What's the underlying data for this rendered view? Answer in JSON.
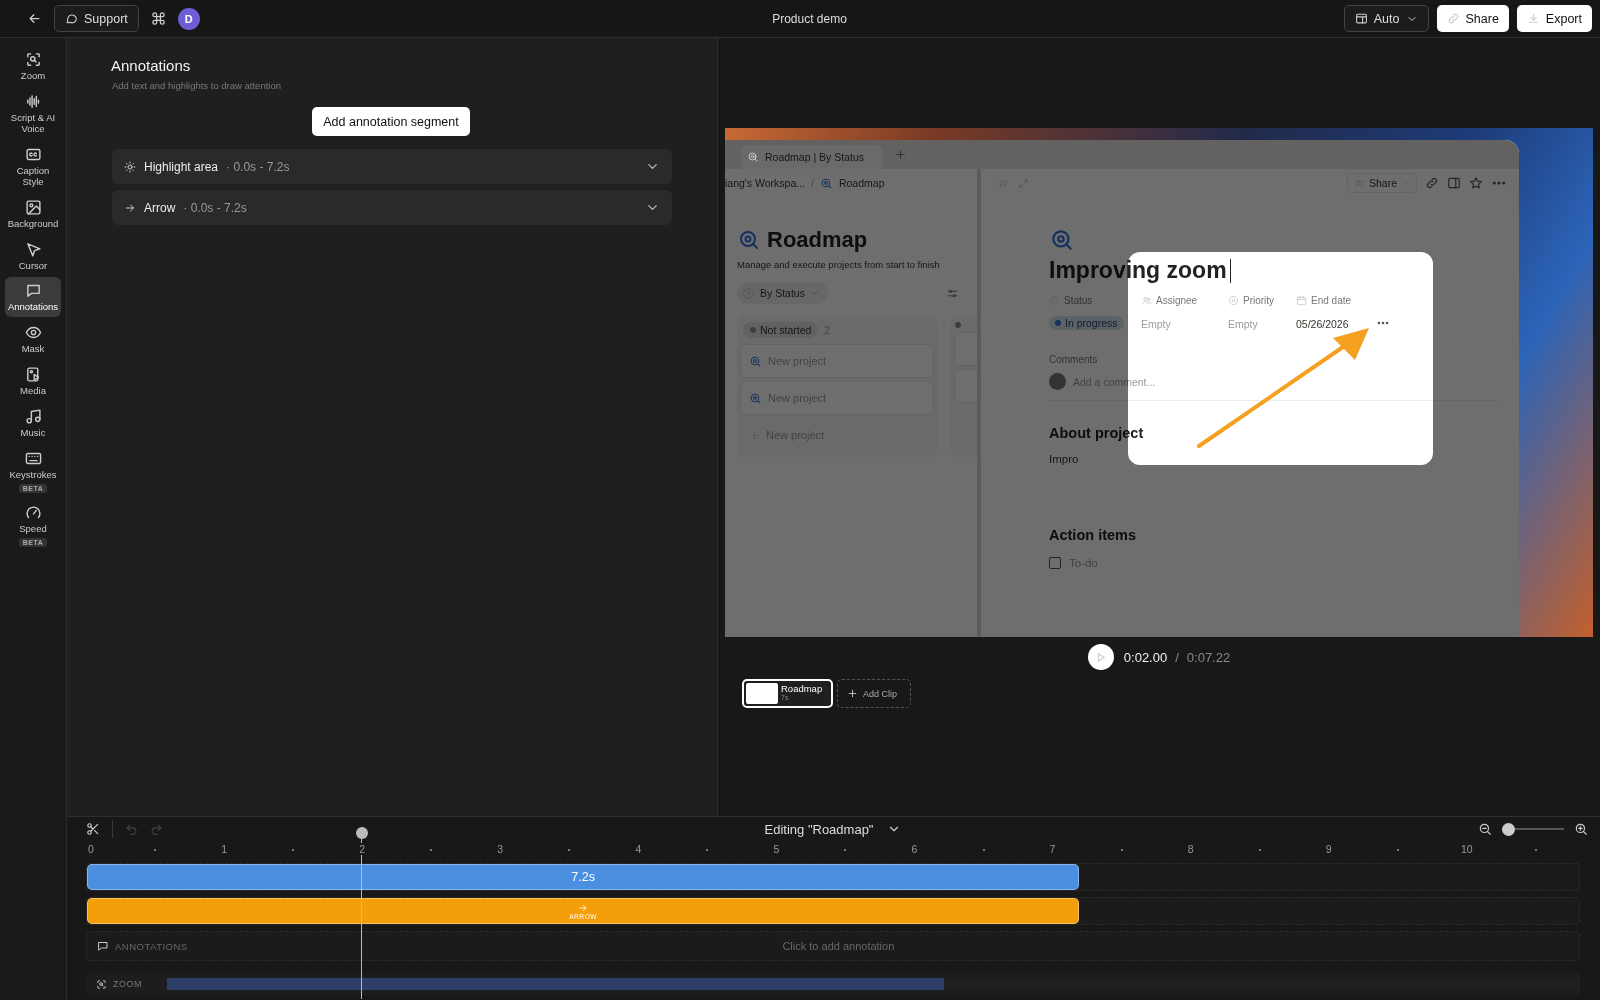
{
  "topbar": {
    "support": "Support",
    "avatar": "D",
    "title": "Product demo",
    "layout": "Auto",
    "share": "Share",
    "export": "Export"
  },
  "sidebar": {
    "items": [
      {
        "label": "Zoom",
        "selected": false
      },
      {
        "label": "Script & AI Voice",
        "selected": false
      },
      {
        "label": "Caption Style",
        "selected": false
      },
      {
        "label": "Background",
        "selected": false
      },
      {
        "label": "Cursor",
        "selected": false
      },
      {
        "label": "Annotations",
        "selected": true
      },
      {
        "label": "Mask",
        "selected": false
      },
      {
        "label": "Media",
        "selected": false
      },
      {
        "label": "Music",
        "selected": false
      },
      {
        "label": "Keystrokes",
        "badge": "BETA",
        "selected": false
      },
      {
        "label": "Speed",
        "badge": "BETA",
        "selected": false
      }
    ]
  },
  "panel": {
    "title": "Annotations",
    "subtitle": "Add text and highlights to draw attention",
    "add_button": "Add annotation segment",
    "segments": [
      {
        "kind": "highlight",
        "name": "Highlight area",
        "range": "· 0.0s - 7.2s",
        "expanded": false
      },
      {
        "kind": "arrow",
        "name": "Arrow",
        "range": "· 0.0s - 7.2s",
        "expanded": false
      }
    ]
  },
  "recording": {
    "tab": "Roadmap | By Status",
    "workspace": "iang's Workspa...",
    "separator": "/",
    "page_crumb": "Roadmap",
    "share": "Share",
    "board": {
      "title": "Roadmap",
      "description": "Manage and execute projects from start to finish",
      "view": "By Status",
      "group": "Not started",
      "count": "2",
      "cards": [
        "New project",
        "New project"
      ],
      "add": "New project"
    },
    "page": {
      "title": "Improving zoom",
      "properties": [
        {
          "kind": "status",
          "label": "Status",
          "value": "In progress"
        },
        {
          "kind": "person",
          "label": "Assignee",
          "value": "Empty"
        },
        {
          "kind": "priority",
          "label": "Priority",
          "value": "Empty"
        },
        {
          "kind": "date",
          "label": "End date",
          "value": "05/26/2026"
        }
      ],
      "comments_label": "Comments",
      "comment_placeholder": "Add a comment...",
      "about_heading": "About project",
      "about_text": "Impro",
      "action_heading": "Action items",
      "todos": [
        {
          "label": "To-do",
          "checked": false
        }
      ]
    }
  },
  "player": {
    "current": "0:02.00",
    "separator": "/",
    "total": "0:07.22"
  },
  "clips": [
    {
      "title": "Roadmap",
      "duration": "7s",
      "selected": true
    }
  ],
  "add_clip": "Add Clip",
  "timeline": {
    "title": "Editing \"Roadmap\"",
    "undo_disabled": true,
    "redo_disabled": true,
    "zoom_slider": {
      "level": 0.1
    },
    "ruler": [
      "0",
      "1",
      "2",
      "3",
      "4",
      "5",
      "6",
      "7",
      "8",
      "9",
      "10"
    ],
    "playhead": {
      "level": 0.185
    },
    "tracks": [
      {
        "kind": "clip",
        "label": "7.2s",
        "level": 0.665
      },
      {
        "kind": "arrow",
        "label": "ARROW",
        "level": 0.665
      }
    ],
    "annotation_row": {
      "label": "ANNOTATIONS",
      "hint": "Click to add annotation"
    },
    "zoom_row": {
      "label": "ZOOM",
      "level": 0.55
    }
  }
}
